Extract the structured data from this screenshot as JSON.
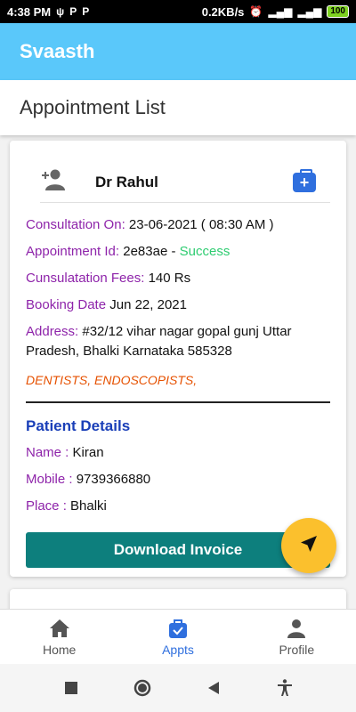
{
  "status_bar": {
    "time": "4:38 PM",
    "net_speed": "0.2KB/s",
    "battery": "100"
  },
  "app": {
    "title": "Svaasth"
  },
  "page": {
    "title": "Appointment List"
  },
  "appointment": {
    "doctor_name": "Dr Rahul",
    "consultation_label": "Consultation On:",
    "consultation_value": "23-06-2021 ( 08:30 AM )",
    "appointment_id_label": "Appointment Id:",
    "appointment_id_value": "2e83ae -",
    "status": "Success",
    "fees_label": "Cunsulatation Fees:",
    "fees_value": "140 Rs",
    "booking_label": "Booking Date",
    "booking_value": "Jun 22, 2021",
    "address_label": "Address:",
    "address_value": "#32/12 vihar nagar gopal gunj Uttar Pradesh, Bhalki Karnataka 585328",
    "specialties": "DENTISTS, ENDOSCOPISTS,",
    "patient_section_title": "Patient Details",
    "patient_name_label": "Name :",
    "patient_name": "Kiran",
    "patient_mobile_label": "Mobile :",
    "patient_mobile": "9739366880",
    "patient_place_label": "Place :",
    "patient_place": "Bhalki",
    "download_label": "Download Invoice"
  },
  "bottom_nav": {
    "items": [
      {
        "label": "Home",
        "icon": "home-icon"
      },
      {
        "label": "Appts",
        "icon": "briefcase-check-icon",
        "active": true
      },
      {
        "label": "Profile",
        "icon": "person-icon"
      }
    ]
  },
  "colors": {
    "app_bar": "#5ac8fa",
    "label": "#8e24aa",
    "success": "#2ecc71",
    "specialty": "#e65100",
    "patient_title": "#1a3fb8",
    "download_button": "#0d7f7d",
    "fab": "#fbc02d",
    "active_nav": "#2f6fde"
  }
}
